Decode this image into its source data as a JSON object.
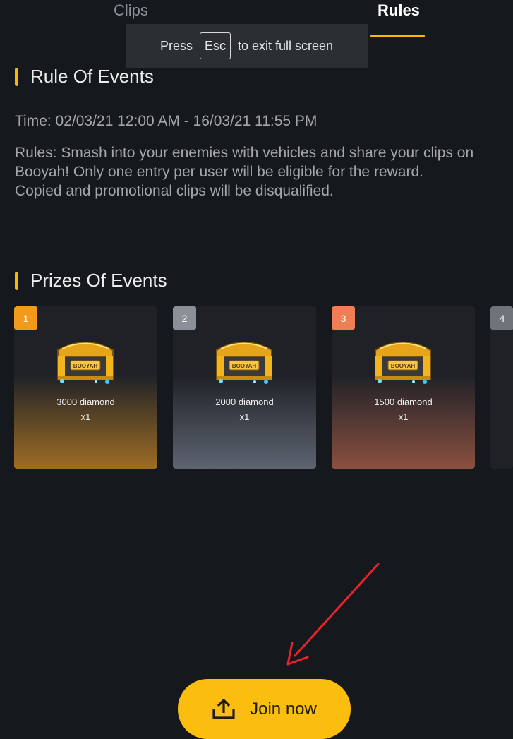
{
  "tabs": [
    {
      "label": "Clips",
      "active": false
    },
    {
      "label": "Rules",
      "active": true
    }
  ],
  "fullscreen_notice": {
    "prefix": "Press",
    "key": "Esc",
    "suffix": "to exit full screen"
  },
  "rules_section": {
    "title": "Rule Of Events",
    "time": "Time: 02/03/21 12:00 AM - 16/03/21 11:55 PM",
    "rules_text": "Rules: Smash into your enemies with vehicles and share your clips on\nBooyah! Only one entry per user will be eligible for the reward.\nCopied and promotional clips will be disqualified."
  },
  "prizes_section": {
    "title": "Prizes Of Events",
    "prizes": [
      {
        "rank": "1",
        "name": "3000 diamond",
        "qty": "x1",
        "badge_color": "#f39a1d"
      },
      {
        "rank": "2",
        "name": "2000 diamond",
        "qty": "x1",
        "badge_color": "#8b9098"
      },
      {
        "rank": "3",
        "name": "1500 diamond",
        "qty": "x1",
        "badge_color": "#ef7f52"
      },
      {
        "rank": "4",
        "badge_color": "#6f737a"
      }
    ]
  },
  "chest_logo_text": "BOOYAH",
  "join_button": {
    "label": "Join now",
    "icon": "upload-icon"
  },
  "annotation": {
    "icon": "red-arrow-icon",
    "color": "#e8242b"
  },
  "colors": {
    "accent": "#f6b900",
    "background": "#15181d",
    "button": "#fbbd0e"
  }
}
